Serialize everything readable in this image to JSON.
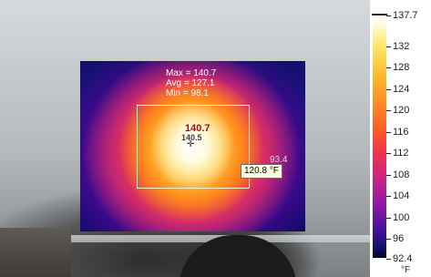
{
  "overlay": {
    "max_label": "Max = 140.7",
    "avg_label": "Avg = 127.1",
    "min_label": "Min = 98.1",
    "max_marker": "140.7",
    "min_marker": "140.5",
    "edge_reading": "93.4",
    "tooltip_value": "120.8",
    "tooltip_unit": "°F",
    "crosshair_icon": "crosshair-icon"
  },
  "scale": {
    "ticks": [
      "137.7",
      "132",
      "128",
      "124",
      "120",
      "116",
      "112",
      "108",
      "104",
      "100",
      "96",
      "92.4"
    ],
    "unit": "°F",
    "palette": [
      "#ffffff",
      "#ffe768",
      "#ff8d22",
      "#ec3150",
      "#8f1aa1",
      "#14106e",
      "#03032b"
    ]
  }
}
